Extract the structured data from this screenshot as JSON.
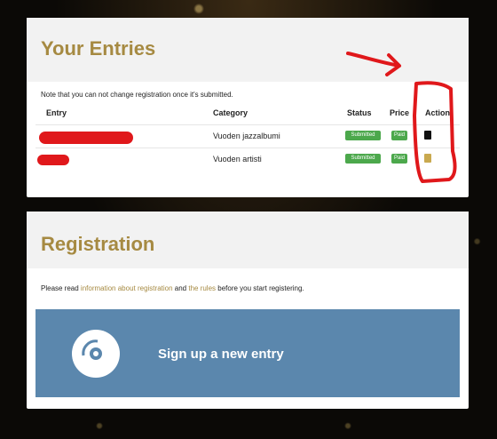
{
  "entries": {
    "title": "Your Entries",
    "note": "Note that you can not change registration once it's submitted.",
    "headers": {
      "entry": "Entry",
      "category": "Category",
      "status": "Status",
      "price": "Price",
      "action": "Action"
    },
    "rows": [
      {
        "category": "Vuoden jazzalbumi",
        "status": "Submitted",
        "price": "Paid",
        "action_icon": "document-icon-black"
      },
      {
        "category": "Vuoden artisti",
        "status": "Submitted",
        "price": "Paid",
        "action_icon": "document-icon-gold"
      }
    ]
  },
  "registration": {
    "title": "Registration",
    "text_before": "Please read ",
    "link1": "information about registration",
    "text_middle": " and ",
    "link2": "the rules",
    "text_after": " before you start registering.",
    "signup_label": "Sign up a new entry",
    "signup_icon": "disc-icon"
  },
  "colors": {
    "accent_gold": "#a68a42",
    "badge_green": "#4ca84c",
    "signup_blue": "#5b87ad",
    "annotation_red": "#e0181b"
  }
}
